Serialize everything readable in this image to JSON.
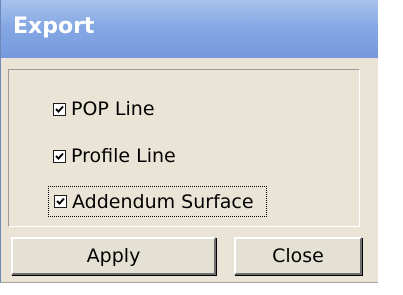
{
  "window": {
    "title": "Export"
  },
  "options": [
    {
      "label": "POP Line",
      "checked": true
    },
    {
      "label": "Profile Line",
      "checked": true
    },
    {
      "label": "Addendum Surface",
      "checked": true,
      "focused": true
    }
  ],
  "buttons": {
    "apply_label": "Apply",
    "close_label": "Close"
  },
  "colors": {
    "titlebar": "#86a8e4",
    "dialog_background": "#e9e4d5",
    "title_text": "#ffffff"
  }
}
